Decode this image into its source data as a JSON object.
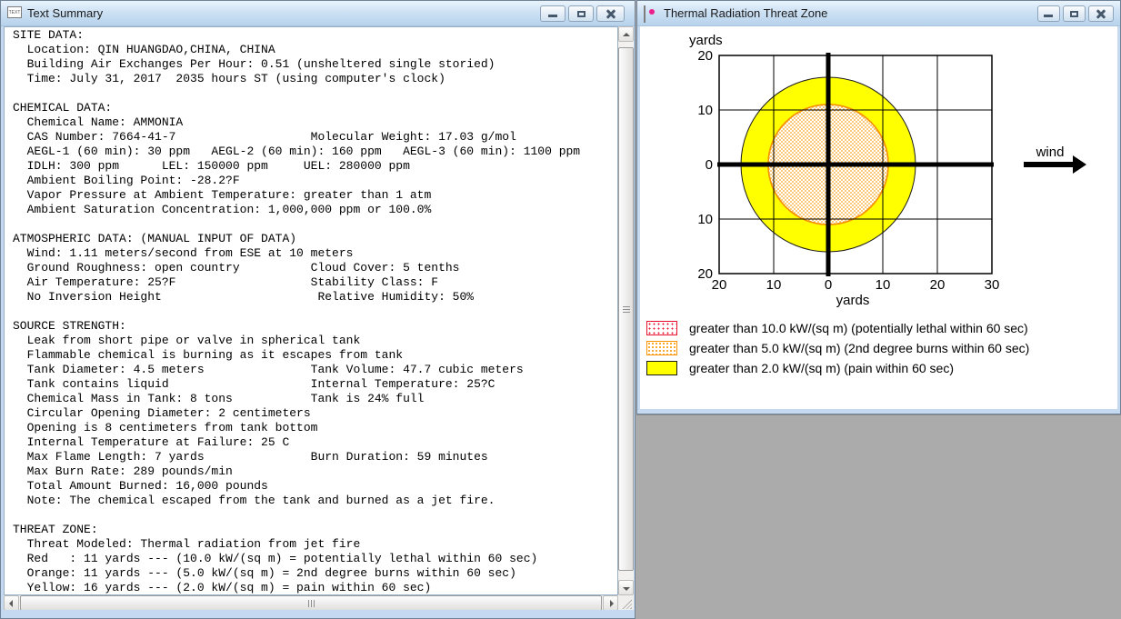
{
  "desktop": {
    "background": "#ababab"
  },
  "text_summary_window": {
    "title": "Text Summary",
    "icon": "text-document-icon",
    "controls": [
      "minimize-icon",
      "maximize-icon",
      "close-icon"
    ],
    "lines": [
      "SITE DATA:",
      "  Location: QIN HUANGDAO,CHINA, CHINA",
      "  Building Air Exchanges Per Hour: 0.51 (unsheltered single storied)",
      "  Time: July 31, 2017  2035 hours ST (using computer's clock)",
      "",
      "CHEMICAL DATA:",
      "  Chemical Name: AMMONIA",
      "  CAS Number: 7664-41-7                   Molecular Weight: 17.03 g/mol",
      "  AEGL-1 (60 min): 30 ppm   AEGL-2 (60 min): 160 ppm   AEGL-3 (60 min): 1100 ppm",
      "  IDLH: 300 ppm      LEL: 150000 ppm     UEL: 280000 ppm",
      "  Ambient Boiling Point: -28.2?F",
      "  Vapor Pressure at Ambient Temperature: greater than 1 atm",
      "  Ambient Saturation Concentration: 1,000,000 ppm or 100.0%",
      "",
      "ATMOSPHERIC DATA: (MANUAL INPUT OF DATA)",
      "  Wind: 1.11 meters/second from ESE at 10 meters",
      "  Ground Roughness: open country          Cloud Cover: 5 tenths",
      "  Air Temperature: 25?F                   Stability Class: F",
      "  No Inversion Height                      Relative Humidity: 50%",
      "",
      "SOURCE STRENGTH:",
      "  Leak from short pipe or valve in spherical tank",
      "  Flammable chemical is burning as it escapes from tank",
      "  Tank Diameter: 4.5 meters               Tank Volume: 47.7 cubic meters",
      "  Tank contains liquid                    Internal Temperature: 25?C",
      "  Chemical Mass in Tank: 8 tons           Tank is 24% full",
      "  Circular Opening Diameter: 2 centimeters",
      "  Opening is 8 centimeters from tank bottom",
      "  Internal Temperature at Failure: 25 C",
      "  Max Flame Length: 7 yards               Burn Duration: 59 minutes",
      "  Max Burn Rate: 289 pounds/min",
      "  Total Amount Burned: 16,000 pounds",
      "  Note: The chemical escaped from the tank and burned as a jet fire.",
      "",
      "THREAT ZONE:",
      "  Threat Modeled: Thermal radiation from jet fire",
      "  Red   : 11 yards --- (10.0 kW/(sq m) = potentially lethal within 60 sec)",
      "  Orange: 11 yards --- (5.0 kW/(sq m) = 2nd degree burns within 60 sec)",
      "  Yellow: 16 yards --- (2.0 kW/(sq m) = pain within 60 sec)"
    ]
  },
  "threat_window": {
    "title": "Thermal Radiation Threat Zone",
    "icon": "threat-zone-plot-icon",
    "controls": [
      "minimize-icon",
      "maximize-icon",
      "close-icon"
    ],
    "legend": [
      {
        "swatch": "red-dotted",
        "label": "greater than 10.0 kW/(sq m) (potentially lethal within 60 sec)"
      },
      {
        "swatch": "orange-dotted",
        "label": "greater than 5.0 kW/(sq m) (2nd degree burns within 60 sec)"
      },
      {
        "swatch": "yellow-solid",
        "label": "greater than 2.0 kW/(sq m) (pain within 60 sec)"
      }
    ]
  },
  "chart_data": {
    "type": "area",
    "title": "Thermal Radiation Threat Zone",
    "xlabel": "yards",
    "ylabel": "yards",
    "xlim": [
      -20,
      30
    ],
    "ylim": [
      -20,
      20
    ],
    "x_ticks": [
      -20,
      -10,
      0,
      10,
      20,
      30
    ],
    "x_tick_labels": [
      "20",
      "10",
      "0",
      "10",
      "20",
      "30"
    ],
    "y_ticks": [
      -20,
      -10,
      0,
      10,
      20
    ],
    "y_tick_labels": [
      "20",
      "10",
      "0",
      "10",
      "20"
    ],
    "grid": true,
    "origin_axes": true,
    "legend_position": "below",
    "zones": [
      {
        "name": "red",
        "threshold_kw_sqm": 10.0,
        "effect": "potentially lethal within 60 sec",
        "radius_yards": 11,
        "center": [
          0,
          0
        ],
        "fill": "red-dotted",
        "color": "#e8112d"
      },
      {
        "name": "orange",
        "threshold_kw_sqm": 5.0,
        "effect": "2nd degree burns within 60 sec",
        "radius_yards": 11,
        "center": [
          0,
          0
        ],
        "fill": "orange-dotted",
        "color": "#f59300"
      },
      {
        "name": "yellow",
        "threshold_kw_sqm": 2.0,
        "effect": "pain within 60 sec",
        "radius_yards": 16,
        "center": [
          0,
          0
        ],
        "fill": "solid",
        "color": "#ffff00"
      }
    ],
    "wind_annotation": {
      "label": "wind",
      "direction": "east"
    }
  }
}
